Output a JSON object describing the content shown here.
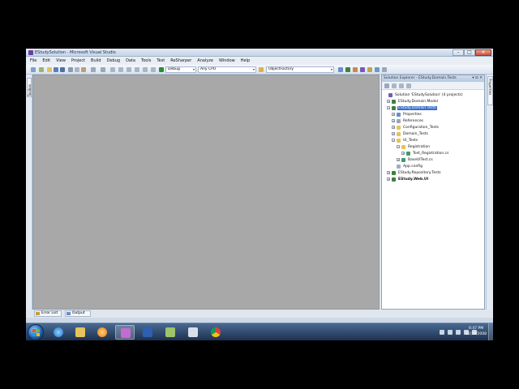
{
  "window": {
    "title": "EStudySolution - Microsoft Visual Studio",
    "minimize": "–",
    "maximize": "□",
    "close": "✕"
  },
  "menu": [
    "File",
    "Edit",
    "View",
    "Project",
    "Build",
    "Debug",
    "Data",
    "Tools",
    "Test",
    "ReSharper",
    "Analyze",
    "Window",
    "Help"
  ],
  "toolbar": {
    "config": "Debug",
    "platform": "Any CPU",
    "find": "ObjectFactory",
    "arrow": "▾"
  },
  "toolbox_tab": "Toolbox",
  "properties_tab": "Properties",
  "solution_explorer": {
    "title": "Solution Explorer - EStudy.Domain.Tests",
    "buttons": "▾ ⊡ ✕",
    "tree": [
      {
        "label": "Solution 'EStudySolution' (4 projects)",
        "exp": "",
        "icon": "sol"
      },
      {
        "label": "EStudy.Domain.Model",
        "exp": "+",
        "icon": "proj"
      },
      {
        "label": "EStudy.Domain.Tests",
        "exp": "−",
        "icon": "proj",
        "selected": true
      },
      {
        "label": "Properties",
        "exp": "+",
        "icon": "props"
      },
      {
        "label": "References",
        "exp": "+",
        "icon": "refs"
      },
      {
        "label": "Configuration_Tests",
        "exp": "+",
        "icon": "folder"
      },
      {
        "label": "Domain_Tests",
        "exp": "+",
        "icon": "folder"
      },
      {
        "label": "UI_Tests",
        "exp": "−",
        "icon": "folder"
      },
      {
        "label": "Registration",
        "exp": "−",
        "icon": "folder"
      },
      {
        "label": "Test_Registration.cs",
        "exp": "+",
        "icon": "cs"
      },
      {
        "label": "BaseUITest.cs",
        "exp": "+",
        "icon": "cs"
      },
      {
        "label": "App.config",
        "exp": "",
        "icon": "config"
      },
      {
        "label": "EStudy.Repository.Tests",
        "exp": "+",
        "icon": "proj"
      },
      {
        "label": "EStudy.Web.UI",
        "exp": "+",
        "icon": "proj",
        "bold": true
      }
    ]
  },
  "bottom_tabs": {
    "error_list": "Error List",
    "output": "Output"
  },
  "taskbar": {
    "time": "6:47 PM",
    "date": "12/29/2008"
  }
}
